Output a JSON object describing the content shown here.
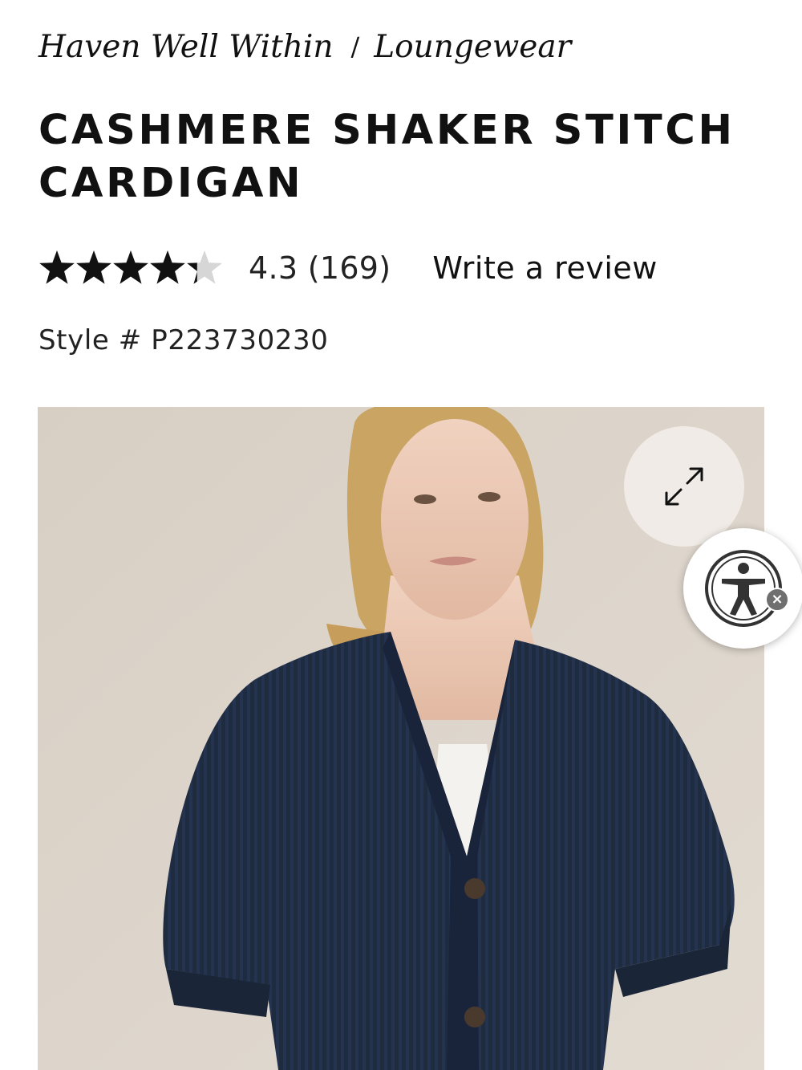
{
  "breadcrumb": {
    "items": [
      "Haven Well Within",
      "Loungewear"
    ],
    "separator": "/"
  },
  "product": {
    "title": "CASHMERE SHAKER STITCH CARDIGAN",
    "rating": 4.3,
    "rating_text": "4.3 (169)",
    "review_count": 169,
    "write_review_label": "Write a review",
    "style_number": "Style # P223730230"
  },
  "icons": {
    "expand": "expand-arrows-icon",
    "accessibility": "accessibility-person-icon",
    "close": "close-icon",
    "star": "star-icon"
  },
  "accessibility_widget": {
    "close_glyph": "×"
  },
  "colors": {
    "text": "#111111",
    "star_filled": "#111111",
    "star_empty": "#d6d6d6",
    "image_background": "#d9d0c6",
    "sweater": "#1f2c40"
  }
}
